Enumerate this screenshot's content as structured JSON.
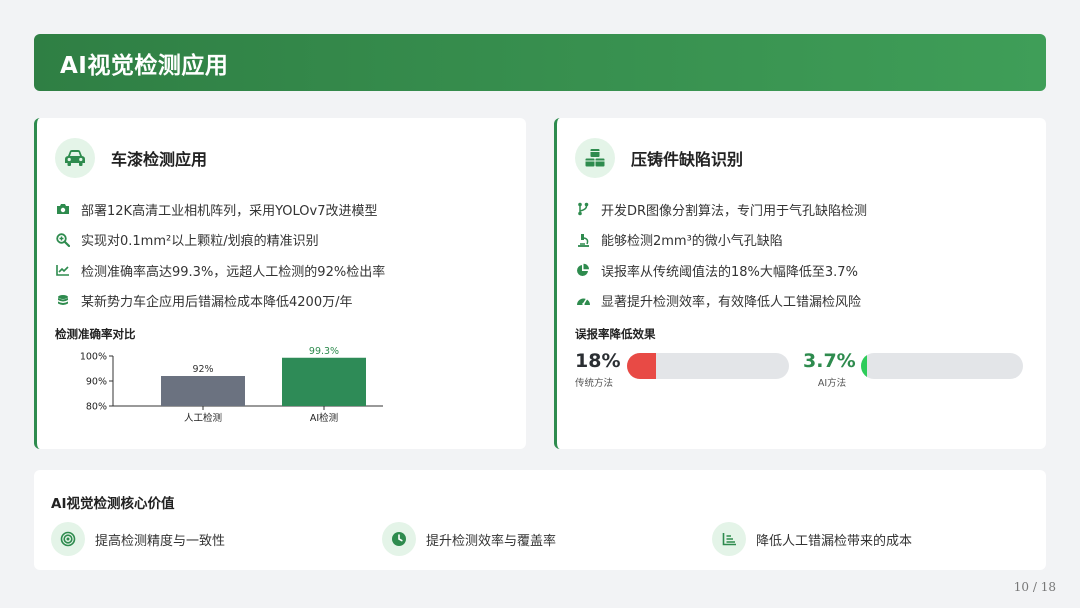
{
  "header": {
    "title": "AI视觉检测应用"
  },
  "left_card": {
    "title": "车漆检测应用",
    "icon": "car-icon",
    "bullets": [
      {
        "icon": "camera-icon",
        "text": "部署12K高清工业相机阵列，采用YOLOv7改进模型"
      },
      {
        "icon": "zoom-icon",
        "text": "实现对0.1mm²以上颗粒/划痕的精准识别"
      },
      {
        "icon": "line-chart-icon",
        "text": "检测准确率高达99.3%，远超人工检测的92%检出率"
      },
      {
        "icon": "coins-icon",
        "text": "某新势力车企应用后错漏检成本降低4200万/年"
      }
    ],
    "chart_label": "检测准确率对比"
  },
  "right_card": {
    "title": "压铸件缺陷识别",
    "icon": "cubes-icon",
    "bullets": [
      {
        "icon": "branch-icon",
        "text": "开发DR图像分割算法，专门用于气孔缺陷检测"
      },
      {
        "icon": "microscope-icon",
        "text": "能够检测2mm³的微小气孔缺陷"
      },
      {
        "icon": "pie-icon",
        "text": "误报率从传统阈值法的18%大幅降低至3.7%"
      },
      {
        "icon": "gauge-icon",
        "text": "显著提升检测效率，有效降低人工错漏检风险"
      }
    ],
    "progress_label": "误报率降低效果",
    "progress": [
      {
        "value_text": "18%",
        "label": "传统方法",
        "value": 18,
        "color": "#e84a45",
        "text_color": "#2b2f33"
      },
      {
        "value_text": "3.7%",
        "label": "AI方法",
        "value": 3.7,
        "color": "#2ecc5a",
        "text_color": "#2e8b4e"
      }
    ]
  },
  "bottom_card": {
    "title": "AI视觉检测核心价值",
    "items": [
      {
        "icon": "target-icon",
        "text": "提高检测精度与一致性"
      },
      {
        "icon": "clock-icon",
        "text": "提升检测效率与覆盖率"
      },
      {
        "icon": "bar-list-icon",
        "text": "降低人工错漏检带来的成本"
      }
    ]
  },
  "page": {
    "number": "10 / 18"
  },
  "chart_data": {
    "type": "bar",
    "categories": [
      "人工检测",
      "AI检测"
    ],
    "values": [
      92,
      99.3
    ],
    "data_labels": [
      "92%",
      "99.3%"
    ],
    "yticks": [
      "80%",
      "90%",
      "100%"
    ],
    "ylim": [
      80,
      100
    ],
    "colors": [
      "#6b7280",
      "#2e8b57"
    ],
    "title": "",
    "xlabel": "",
    "ylabel": ""
  }
}
